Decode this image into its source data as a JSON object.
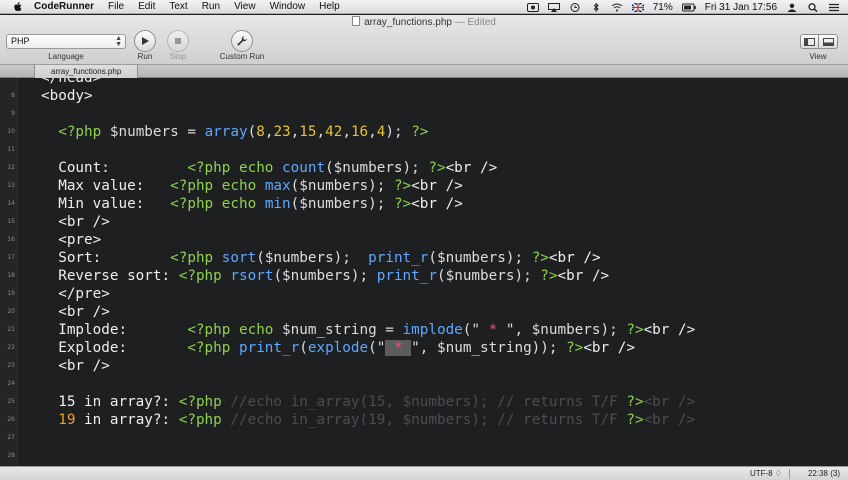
{
  "menubar": {
    "app_name": "CodeRunner",
    "items": [
      "File",
      "Edit",
      "Text",
      "Run",
      "View",
      "Window",
      "Help"
    ],
    "battery": "71%",
    "datetime": "Fri 31 Jan  17:56"
  },
  "window": {
    "title": "array_functions.php",
    "edited": "— Edited"
  },
  "toolbar": {
    "language_value": "PHP",
    "language_label": "Language",
    "run_label": "Run",
    "stop_label": "Stop",
    "custom_run_label": "Custom Run",
    "view_label": "View"
  },
  "tab": {
    "label": "array_functions.php"
  },
  "editor": {
    "line_numbers": [
      "",
      "8",
      "9",
      "10",
      "11",
      "12",
      "13",
      "14",
      "15",
      "16",
      "17",
      "18",
      "19",
      "20",
      "21",
      "22",
      "23",
      "24",
      "25",
      "26",
      "27",
      "28"
    ],
    "lines": [
      {
        "tokens": [
          {
            "t": "</head>",
            "c": "c-html"
          }
        ]
      },
      {
        "tokens": [
          {
            "t": "<body>",
            "c": "c-html"
          }
        ]
      },
      {
        "tokens": []
      },
      {
        "tokens": [
          {
            "t": "  <?php ",
            "c": "c-php"
          },
          {
            "t": "$numbers",
            "c": "c-var"
          },
          {
            "t": " = ",
            "c": "c-var"
          },
          {
            "t": "array",
            "c": "c-fn"
          },
          {
            "t": "(",
            "c": "c-var"
          },
          {
            "t": "8",
            "c": "c-num"
          },
          {
            "t": ",",
            "c": "c-var"
          },
          {
            "t": "23",
            "c": "c-num"
          },
          {
            "t": ",",
            "c": "c-var"
          },
          {
            "t": "15",
            "c": "c-num"
          },
          {
            "t": ",",
            "c": "c-var"
          },
          {
            "t": "42",
            "c": "c-num"
          },
          {
            "t": ",",
            "c": "c-var"
          },
          {
            "t": "16",
            "c": "c-num"
          },
          {
            "t": ",",
            "c": "c-var"
          },
          {
            "t": "4",
            "c": "c-num"
          },
          {
            "t": "); ",
            "c": "c-var"
          },
          {
            "t": "?>",
            "c": "c-php"
          }
        ]
      },
      {
        "tokens": []
      },
      {
        "tokens": [
          {
            "t": "  Count:         ",
            "c": "c-html"
          },
          {
            "t": "<?php echo ",
            "c": "c-php"
          },
          {
            "t": "count",
            "c": "c-fn"
          },
          {
            "t": "($numbers); ",
            "c": "c-var"
          },
          {
            "t": "?>",
            "c": "c-php"
          },
          {
            "t": "<br />",
            "c": "c-html"
          }
        ]
      },
      {
        "tokens": [
          {
            "t": "  Max value:   ",
            "c": "c-html"
          },
          {
            "t": "<?php echo ",
            "c": "c-php"
          },
          {
            "t": "max",
            "c": "c-fn"
          },
          {
            "t": "($numbers); ",
            "c": "c-var"
          },
          {
            "t": "?>",
            "c": "c-php"
          },
          {
            "t": "<br />",
            "c": "c-html"
          }
        ]
      },
      {
        "tokens": [
          {
            "t": "  Min value:   ",
            "c": "c-html"
          },
          {
            "t": "<?php echo ",
            "c": "c-php"
          },
          {
            "t": "min",
            "c": "c-fn"
          },
          {
            "t": "($numbers); ",
            "c": "c-var"
          },
          {
            "t": "?>",
            "c": "c-php"
          },
          {
            "t": "<br />",
            "c": "c-html"
          }
        ]
      },
      {
        "tokens": [
          {
            "t": "  <br />",
            "c": "c-html"
          }
        ]
      },
      {
        "tokens": [
          {
            "t": "  <pre>",
            "c": "c-html"
          }
        ]
      },
      {
        "tokens": [
          {
            "t": "  Sort:        ",
            "c": "c-html"
          },
          {
            "t": "<?php ",
            "c": "c-php"
          },
          {
            "t": "sort",
            "c": "c-fn"
          },
          {
            "t": "($numbers);  ",
            "c": "c-var"
          },
          {
            "t": "print_r",
            "c": "c-fn"
          },
          {
            "t": "($numbers); ",
            "c": "c-var"
          },
          {
            "t": "?>",
            "c": "c-php"
          },
          {
            "t": "<br />",
            "c": "c-html"
          }
        ]
      },
      {
        "tokens": [
          {
            "t": "  Reverse sort: ",
            "c": "c-html"
          },
          {
            "t": "<?php ",
            "c": "c-php"
          },
          {
            "t": "rsort",
            "c": "c-fn"
          },
          {
            "t": "($numbers); ",
            "c": "c-var"
          },
          {
            "t": "print_r",
            "c": "c-fn"
          },
          {
            "t": "($numbers); ",
            "c": "c-var"
          },
          {
            "t": "?>",
            "c": "c-php"
          },
          {
            "t": "<br />",
            "c": "c-html"
          }
        ]
      },
      {
        "tokens": [
          {
            "t": "  </pre>",
            "c": "c-html"
          }
        ]
      },
      {
        "tokens": [
          {
            "t": "  <br />",
            "c": "c-html"
          }
        ]
      },
      {
        "tokens": [
          {
            "t": "  Implode:       ",
            "c": "c-html"
          },
          {
            "t": "<?php echo ",
            "c": "c-php"
          },
          {
            "t": "$num_string = ",
            "c": "c-var"
          },
          {
            "t": "implode",
            "c": "c-fn"
          },
          {
            "t": "(\"",
            "c": "c-var"
          },
          {
            "t": " * ",
            "c": "c-star"
          },
          {
            "t": "\", $numbers); ",
            "c": "c-var"
          },
          {
            "t": "?>",
            "c": "c-php"
          },
          {
            "t": "<br />",
            "c": "c-html"
          }
        ]
      },
      {
        "tokens": [
          {
            "t": "  Explode:       ",
            "c": "c-html"
          },
          {
            "t": "<?php ",
            "c": "c-php"
          },
          {
            "t": "print_r",
            "c": "c-fn"
          },
          {
            "t": "(",
            "c": "c-var"
          },
          {
            "t": "explode",
            "c": "c-fn"
          },
          {
            "t": "(\"",
            "c": "c-var"
          },
          {
            "t": " * ",
            "c": "c-star c-sel"
          },
          {
            "t": "\", $num_string)); ",
            "c": "c-var"
          },
          {
            "t": "?>",
            "c": "c-php"
          },
          {
            "t": "<br />",
            "c": "c-html"
          }
        ]
      },
      {
        "tokens": [
          {
            "t": "  <br />",
            "c": "c-html"
          }
        ]
      },
      {
        "tokens": []
      },
      {
        "tokens": [
          {
            "t": "  15 in array?: ",
            "c": "c-html"
          },
          {
            "t": "<?php ",
            "c": "c-php"
          },
          {
            "t": "//echo in_array(15, $numbers); // returns T/F ",
            "c": "c-com"
          },
          {
            "t": "?>",
            "c": "c-php"
          },
          {
            "t": "<br />",
            "c": "c-com"
          }
        ]
      },
      {
        "tokens": [
          {
            "t": "  19",
            "c": "c-orange"
          },
          {
            "t": " in array?: ",
            "c": "c-html"
          },
          {
            "t": "<?php ",
            "c": "c-php"
          },
          {
            "t": "//echo in_array(19, $numbers); // returns T/F ",
            "c": "c-com"
          },
          {
            "t": "?>",
            "c": "c-php"
          },
          {
            "t": "<br />",
            "c": "c-com"
          }
        ]
      },
      {
        "tokens": []
      },
      {
        "tokens": []
      }
    ]
  },
  "statusbar": {
    "encoding": "UTF-8 ♢",
    "position": "22:38 (3)"
  }
}
